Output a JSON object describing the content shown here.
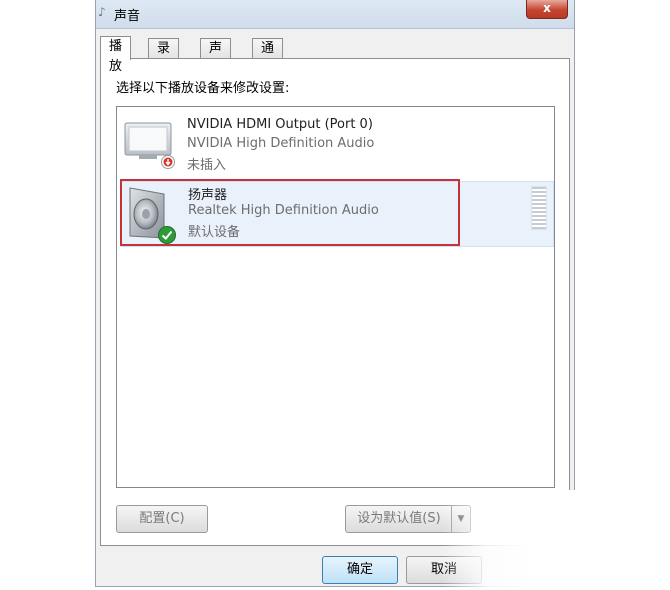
{
  "window": {
    "title": "声音",
    "close_label": "x"
  },
  "tabs": [
    {
      "label": "播放"
    },
    {
      "label": "录制"
    },
    {
      "label": "声音"
    },
    {
      "label": "通信"
    }
  ],
  "playback": {
    "instruction": "选择以下播放设备来修改设置:",
    "devices": [
      {
        "name": "NVIDIA HDMI Output (Port 0)",
        "description": "NVIDIA High Definition Audio",
        "status": "未插入",
        "icon": "monitor-icon"
      },
      {
        "name": "扬声器",
        "description": "Realtek High Definition Audio",
        "status": "默认设备",
        "icon": "speaker-icon"
      }
    ]
  },
  "buttons": {
    "configure": "配置(C)",
    "set_default": "设为默认值(S)",
    "ok": "确定",
    "cancel": "取消"
  },
  "colors": {
    "selection_highlight": "#c9313a",
    "titlebar": "#cfdceb"
  }
}
